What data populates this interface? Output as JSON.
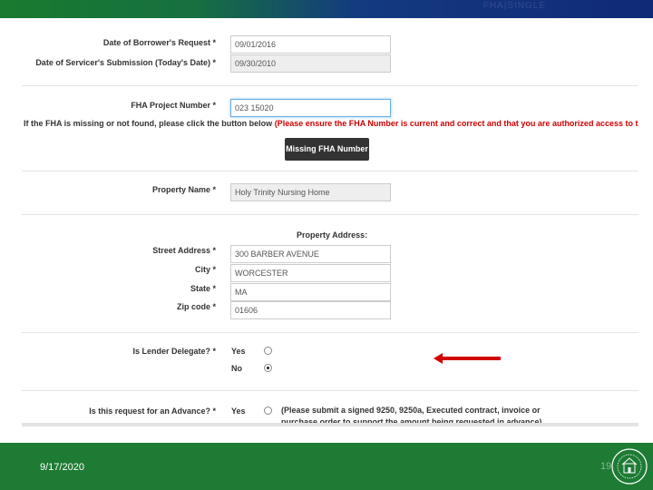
{
  "header": {
    "faint_text": "FHA|SINGLE"
  },
  "form": {
    "date_requested": {
      "label": "Date of Borrower's Request *",
      "value": "09/01/2016"
    },
    "date_submission": {
      "label": "Date of Servicer's Submission (Today's Date) *",
      "value": "09/30/2010"
    },
    "fha_project": {
      "label": "FHA Project Number *",
      "value": "023 15020"
    },
    "fha_note": {
      "prefix": "If the FHA is missing or not found, please click the button below ",
      "emphasis": "(Please ensure the FHA Number is current and correct and that you are authorized access to this property):"
    },
    "missing_fha_button": "Missing FHA Number",
    "property_name": {
      "label": "Property Name *",
      "value": "Holy Trinity Nursing Home"
    },
    "property_address_heading": "Property Address:",
    "street": {
      "label": "Street Address *",
      "value": "300 BARBER AVENUE"
    },
    "city": {
      "label": "City *",
      "value": "WORCESTER"
    },
    "state": {
      "label": "State *",
      "value": "MA"
    },
    "zip": {
      "label": "Zip code *",
      "value": "01606"
    },
    "lender_delegate": {
      "label": "Is Lender Delegate? *",
      "options": [
        {
          "label": "Yes",
          "selected": false
        },
        {
          "label": "No",
          "selected": true
        }
      ]
    },
    "advance": {
      "label": "Is this request for an Advance? *",
      "option": "Yes",
      "note_line1": "(Please submit a signed 9250, 9250a, Executed contract, invoice or",
      "note_line2": "purchase order to support the amount being requested in advance)"
    }
  },
  "footer": {
    "date": "9/17/2020",
    "page": "19"
  },
  "colors": {
    "accent_red": "#cc0000",
    "footer_green": "#1e7b34"
  }
}
